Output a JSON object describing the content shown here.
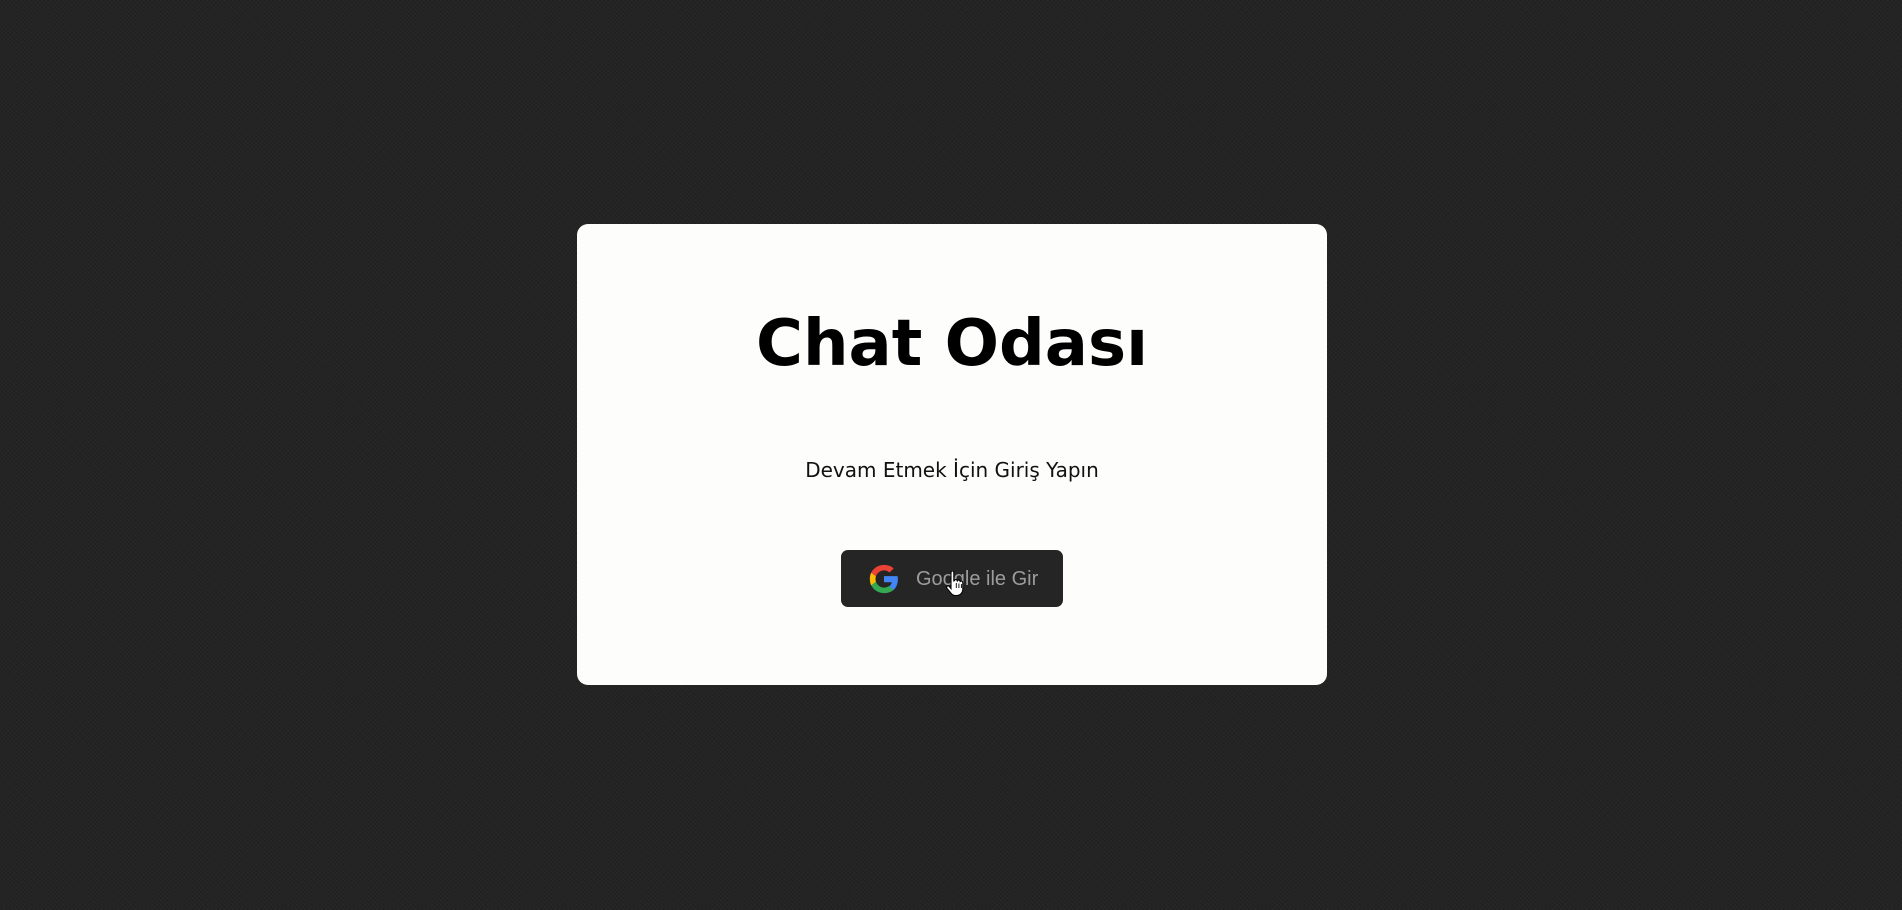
{
  "page": {
    "background_color": "#232323",
    "card_color": "#fdfdfc"
  },
  "login_card": {
    "title": "Chat Odası",
    "subtitle": "Devam Etmek İçin Giriş Yapın",
    "google_button": {
      "label": "Google ile Gir",
      "icon": "google-g-icon",
      "background_color": "#252525",
      "text_color": "#9c9c9c"
    }
  },
  "cursor": {
    "type": "hand-pointer-icon",
    "hovering": "google-login-button"
  }
}
